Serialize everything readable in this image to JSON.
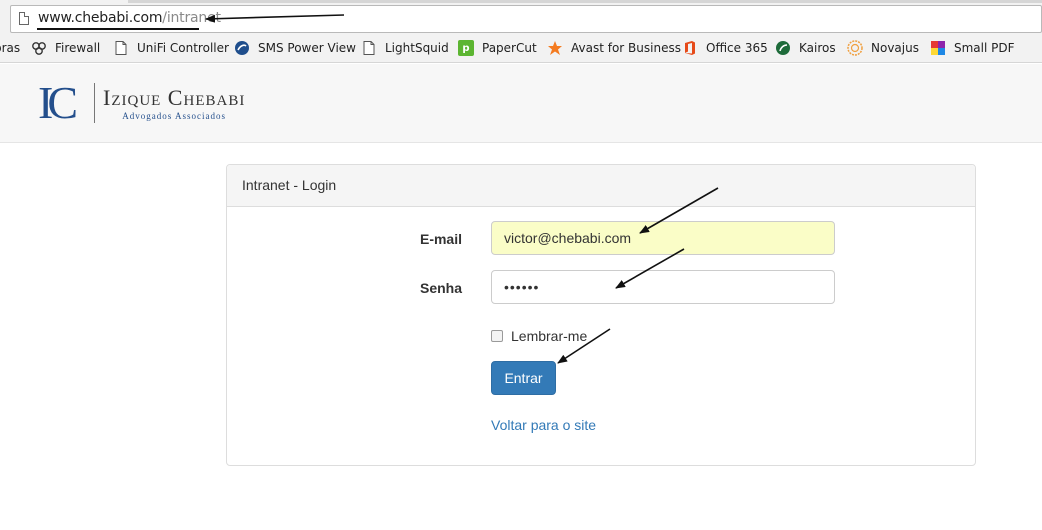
{
  "browser": {
    "url_domain": "www.chebabi.com",
    "url_path": "/intranet",
    "bookmarks": [
      {
        "label": "bras",
        "icon": "none"
      },
      {
        "label": "Firewall",
        "icon": "firewall-icon"
      },
      {
        "label": "UniFi Controller",
        "icon": "page-icon"
      },
      {
        "label": "SMS Power View",
        "icon": "globe-icon"
      },
      {
        "label": "LightSquid",
        "icon": "page-icon"
      },
      {
        "label": "PaperCut",
        "icon": "papercut-icon"
      },
      {
        "label": "Avast for Business",
        "icon": "avast-icon"
      },
      {
        "label": "Office 365",
        "icon": "office-icon"
      },
      {
        "label": "Kairos",
        "icon": "kairos-icon"
      },
      {
        "label": "Novajus",
        "icon": "novajus-icon"
      },
      {
        "label": "Small PDF",
        "icon": "smallpdf-icon"
      }
    ]
  },
  "header": {
    "logo_mark": "IC",
    "firm_name": "Izique Chebabi",
    "firm_subtitle": "Advogados Associados"
  },
  "login": {
    "title": "Intranet - Login",
    "email_label": "E-mail",
    "email_value": "victor@chebabi.com",
    "password_label": "Senha",
    "password_value": "••••••",
    "remember_label": "Lembrar-me",
    "submit_label": "Entrar",
    "back_link": "Voltar para o site"
  },
  "colors": {
    "primary": "#337ab7",
    "autofill": "#fafdc7",
    "logo_blue": "#244f8c"
  }
}
